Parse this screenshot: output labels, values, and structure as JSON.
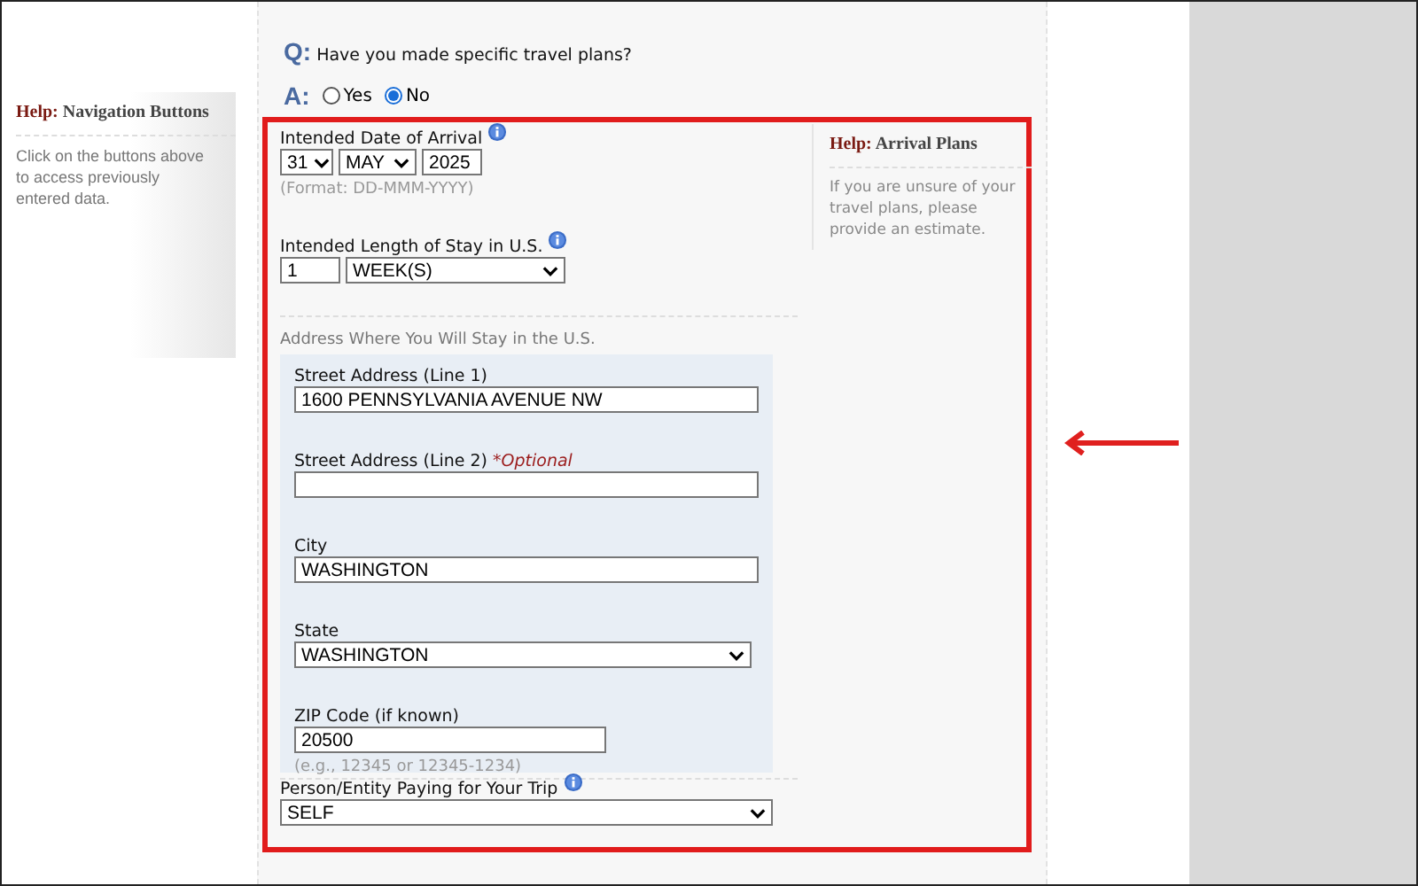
{
  "side_help": {
    "prefix": "Help:",
    "title": "Navigation Buttons",
    "text": "Click on the buttons above to access previously entered data."
  },
  "question": {
    "mark": "Q:",
    "text": "Have you made specific travel plans?"
  },
  "answer": {
    "mark": "A:",
    "options": [
      {
        "label": "Yes",
        "selected": false
      },
      {
        "label": "No",
        "selected": true
      }
    ]
  },
  "arrival_date": {
    "label": "Intended Date of Arrival",
    "day": "31",
    "month": "MAY",
    "year": "2025",
    "hint": "(Format: DD-MMM-YYYY)"
  },
  "length_of_stay": {
    "label": "Intended Length of Stay in U.S.",
    "number": "1",
    "unit": "WEEK(S)"
  },
  "address": {
    "heading": "Address Where You Will Stay in the U.S.",
    "fields": [
      {
        "kind": "text",
        "label": "Street Address (Line 1)",
        "value": "1600 PENNSYLVANIA AVENUE NW"
      },
      {
        "kind": "text",
        "label": "Street Address (Line 2)",
        "note": "*Optional"
      },
      {
        "kind": "text",
        "label": "City",
        "value": "WASHINGTON"
      },
      {
        "kind": "select",
        "label": "State",
        "value": "WASHINGTON"
      },
      {
        "kind": "short",
        "label": "ZIP Code (if known)",
        "value": "20500",
        "hint": "(e.g., 12345 or 12345-1234)"
      }
    ]
  },
  "payer": {
    "label": "Person/Entity Paying for Your Trip",
    "value": "SELF"
  },
  "help_panel": {
    "prefix": "Help:",
    "title": "Arrival Plans",
    "text": "If you are unsure of your travel plans, please provide an estimate."
  }
}
